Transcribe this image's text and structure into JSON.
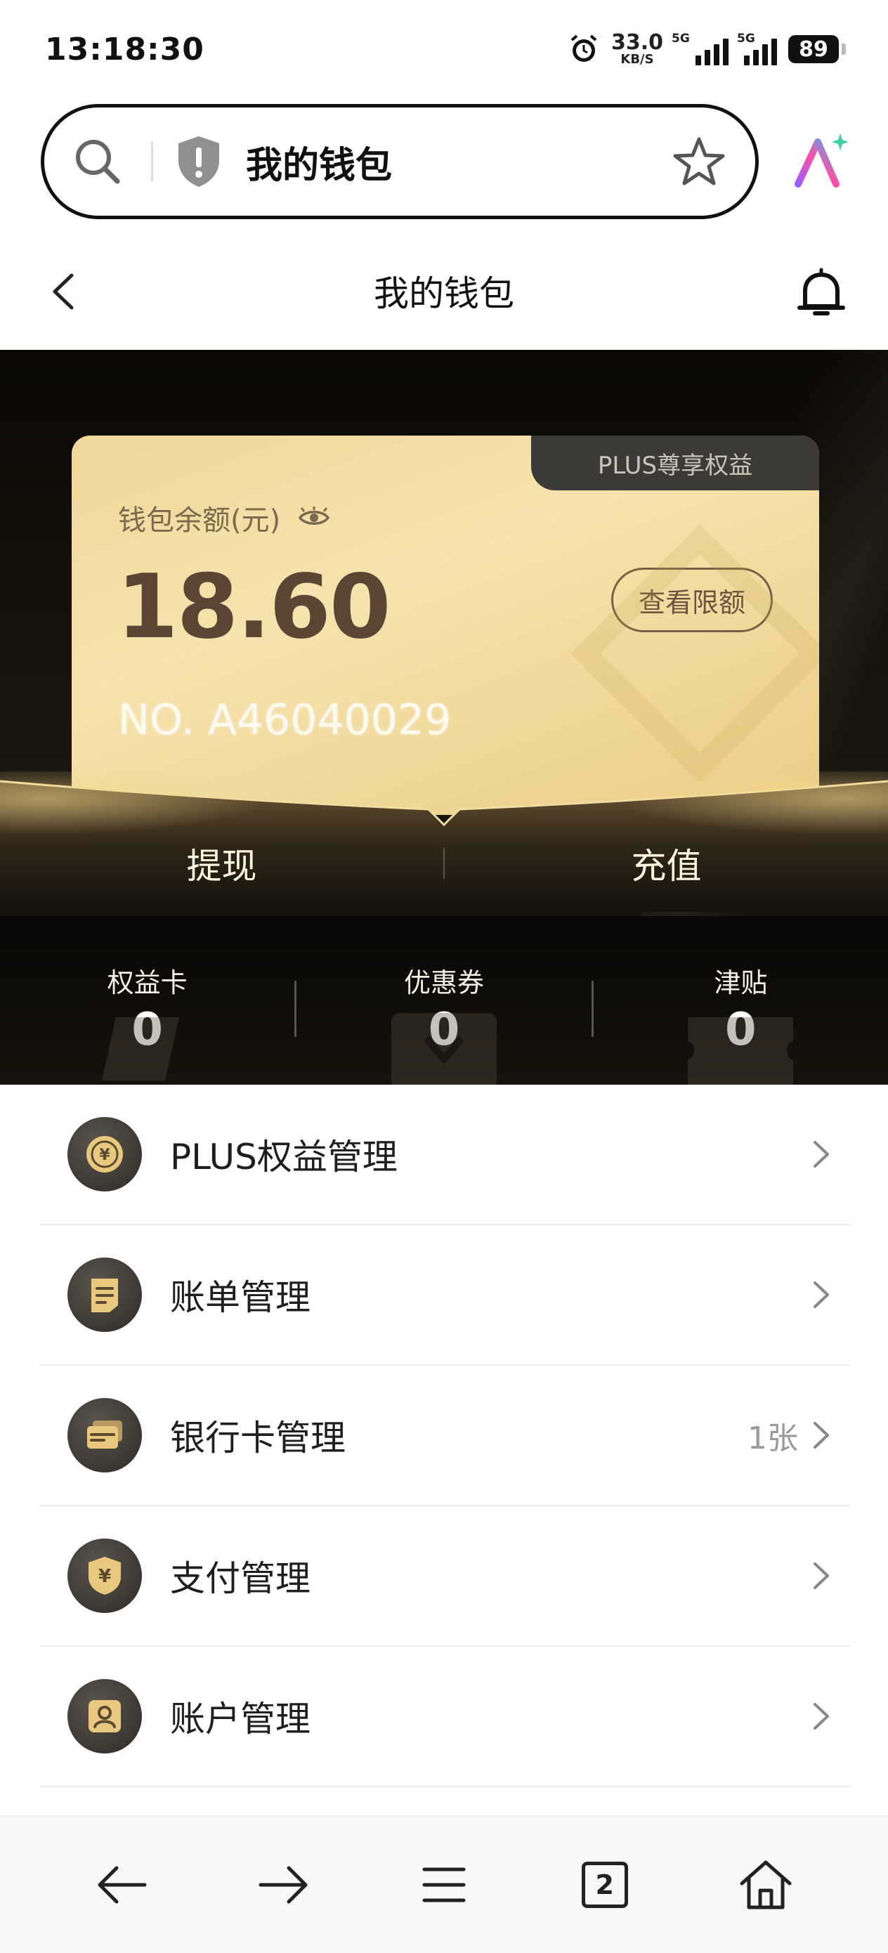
{
  "status_bar": {
    "time": "13:18:30",
    "net_speed_value": "33.0",
    "net_speed_unit": "KB/S",
    "signal_1_tag": "5G",
    "signal_2_tag": "5G",
    "battery": "89"
  },
  "search": {
    "title": "我的钱包"
  },
  "header": {
    "title": "我的钱包"
  },
  "wallet": {
    "plus_tab": "PLUS尊享权益",
    "balance_label": "钱包余额(元)",
    "balance": "18.60",
    "limit_button": "查看限额",
    "card_number": "NO. A46040029",
    "withdraw": "提现",
    "recharge": "充值"
  },
  "stats": [
    {
      "label": "权益卡",
      "value": "0"
    },
    {
      "label": "优惠券",
      "value": "0"
    },
    {
      "label": "津贴",
      "value": "0"
    }
  ],
  "menu": [
    {
      "label": "PLUS权益管理",
      "extra": "",
      "icon": "plus-coin-icon"
    },
    {
      "label": "账单管理",
      "extra": "",
      "icon": "bill-icon"
    },
    {
      "label": "银行卡管理",
      "extra": "1张",
      "icon": "bank-card-icon"
    },
    {
      "label": "支付管理",
      "extra": "",
      "icon": "pay-shield-icon"
    },
    {
      "label": "账户管理",
      "extra": "",
      "icon": "account-icon"
    }
  ],
  "bottom_nav": {
    "tabs_count": "2"
  },
  "colors": {
    "gold_light": "#f6e3ad",
    "gold_dark": "#5b4635",
    "dark_bg": "#15110a",
    "icon_gold": "#e8c77f"
  }
}
